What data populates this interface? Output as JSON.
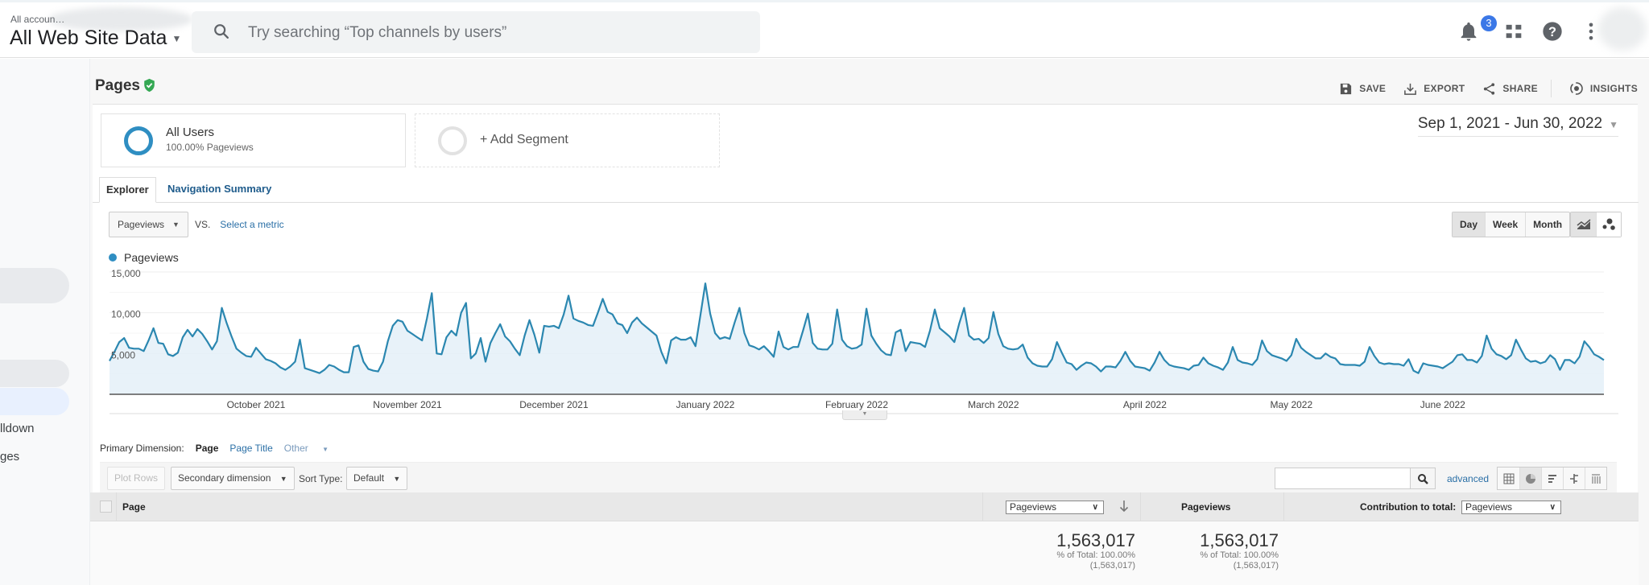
{
  "topbar": {
    "account_small": "All accoun…",
    "property_view": "All Web Site Data",
    "search_placeholder": "Try searching “Top channels by users”",
    "notification_count": "3",
    "icons": [
      "notifications-bell-icon",
      "apps-grid-icon",
      "help-icon",
      "more-vert-icon"
    ]
  },
  "sidebar": {
    "fragments": [
      "lldown",
      "ges"
    ]
  },
  "page": {
    "title": "Pages",
    "actions": [
      {
        "label": "SAVE",
        "icon": "save-icon"
      },
      {
        "label": "EXPORT",
        "icon": "export-icon"
      },
      {
        "label": "SHARE",
        "icon": "share-icon"
      },
      {
        "label": "INSIGHTS",
        "icon": "insights-icon"
      }
    ],
    "date_range": "Sep 1, 2021 - Jun 30, 2022"
  },
  "segments": [
    {
      "title": "All Users",
      "subtitle": "100.00% Pageviews",
      "color": "#2f8ec2"
    },
    {
      "title": "+ Add Segment",
      "subtitle": ""
    }
  ],
  "tabs": [
    {
      "label": "Explorer",
      "active": true
    },
    {
      "label": "Navigation Summary",
      "active": false
    }
  ],
  "metric_selector": {
    "metric": "Pageviews",
    "vs_label": "VS.",
    "compare_link": "Select a metric"
  },
  "granularity": {
    "options": [
      "Day",
      "Week",
      "Month"
    ],
    "selected": "Day"
  },
  "chart_type_buttons": [
    "line-chart-icon",
    "motion-chart-icon"
  ],
  "chart_data": {
    "type": "area",
    "title": "",
    "legend": [
      {
        "name": "Pageviews",
        "color": "#2f8ec2"
      }
    ],
    "legend_placement": "top-left",
    "xlabel": "",
    "ylabel": "",
    "ylim": [
      0,
      15000
    ],
    "yticks": [
      5000,
      10000,
      15000
    ],
    "ytick_labels": [
      "5,000",
      "10,000",
      "15,000"
    ],
    "x_start": "Sep 1, 2021",
    "x_end": "Jun 30, 2022",
    "xtick_labels": [
      {
        "label": "October 2021",
        "day_index": 30
      },
      {
        "label": "November 2021",
        "day_index": 61
      },
      {
        "label": "December 2021",
        "day_index": 91
      },
      {
        "label": "January 2022",
        "day_index": 122
      },
      {
        "label": "February 2022",
        "day_index": 153
      },
      {
        "label": "March 2022",
        "day_index": 181
      },
      {
        "label": "April 2022",
        "day_index": 212
      },
      {
        "label": "May 2022",
        "day_index": 242
      },
      {
        "label": "June 2022",
        "day_index": 273
      }
    ],
    "series": [
      {
        "name": "Pageviews",
        "values": [
          4100,
          5200,
          6400,
          6900,
          5700,
          5600,
          5600,
          5300,
          6600,
          8100,
          6300,
          6200,
          4900,
          4700,
          5100,
          7000,
          7900,
          7100,
          8000,
          7400,
          6500,
          5500,
          6500,
          10600,
          8700,
          7100,
          5600,
          5100,
          4700,
          4600,
          5700,
          5000,
          4300,
          4100,
          3800,
          3300,
          3000,
          3400,
          4000,
          6700,
          3200,
          3000,
          2800,
          2600,
          3000,
          3600,
          3400,
          3000,
          2700,
          2700,
          5800,
          6000,
          4000,
          3100,
          2900,
          2800,
          4000,
          6500,
          8400,
          9100,
          8900,
          7800,
          7400,
          7000,
          6600,
          9300,
          12400,
          5000,
          4900,
          7000,
          7800,
          7200,
          10000,
          11200,
          4400,
          5000,
          6900,
          4000,
          6300,
          7500,
          8600,
          7100,
          6500,
          5600,
          4800,
          7200,
          9100,
          7300,
          5100,
          8400,
          8300,
          8400,
          8100,
          9800,
          12100,
          9300,
          9000,
          8800,
          8500,
          8400,
          10000,
          11700,
          10100,
          9800,
          8700,
          8500,
          7500,
          8800,
          9400,
          8700,
          8200,
          7700,
          7200,
          5200,
          3800,
          6600,
          7000,
          6700,
          6700,
          7000,
          5900,
          9700,
          13600,
          9900,
          7500,
          6800,
          7000,
          6800,
          8800,
          10600,
          7500,
          6000,
          5800,
          5500,
          5900,
          5300,
          4600,
          7700,
          5800,
          5500,
          5800,
          5800,
          7800,
          9900,
          6300,
          5600,
          5500,
          5500,
          6200,
          10400,
          6700,
          5900,
          5600,
          5700,
          6100,
          10500,
          7200,
          6200,
          5400,
          4900,
          4800,
          7600,
          7900,
          5300,
          6400,
          6300,
          6200,
          5800,
          7800,
          10400,
          8100,
          7600,
          7100,
          6400,
          8700,
          10600,
          7200,
          6700,
          6800,
          6300,
          6900,
          10100,
          7400,
          5900,
          5600,
          5500,
          5600,
          6100,
          4500,
          3800,
          3500,
          3400,
          3400,
          4300,
          6400,
          5100,
          3900,
          3700,
          3000,
          3500,
          3900,
          3800,
          3400,
          2800,
          3400,
          3400,
          3300,
          4100,
          5200,
          4100,
          3400,
          3300,
          3200,
          2900,
          3900,
          5200,
          4200,
          3600,
          3400,
          3300,
          3200,
          3000,
          3500,
          3600,
          4500,
          3800,
          3500,
          3300,
          3000,
          3900,
          5800,
          4200,
          3900,
          3800,
          3600,
          4300,
          6600,
          5300,
          4800,
          4600,
          4400,
          4100,
          4800,
          6800,
          5700,
          5200,
          4800,
          4400,
          4400,
          5000,
          4600,
          4400,
          3700,
          3600,
          3600,
          3600,
          3500,
          4000,
          5800,
          4700,
          3900,
          3700,
          3800,
          3700,
          3700,
          3500,
          4300,
          2900,
          2600,
          3800,
          3600,
          3500,
          3400,
          3200,
          3600,
          4000,
          4800,
          4900,
          4200,
          4200,
          3900,
          4700,
          7200,
          5600,
          4900,
          4700,
          4300,
          4800,
          6700,
          5500,
          4400,
          4000,
          4100,
          3800,
          4000,
          4800,
          4300,
          3000,
          4200,
          4200,
          3800,
          4600,
          6500,
          5800,
          4900,
          4600,
          4200
        ]
      }
    ]
  },
  "primary_dimension": {
    "label": "Primary Dimension:",
    "selected": "Page",
    "options": [
      "Page Title",
      "Other"
    ]
  },
  "table_toolbar": {
    "plot_rows": "Plot Rows",
    "secondary_dimension": "Secondary dimension",
    "sort_type_label": "Sort Type:",
    "sort_type_value": "Default",
    "search_value": "",
    "advanced_link": "advanced",
    "view_icons": [
      "data-table-icon",
      "percentage-pie-icon",
      "performance-bars-icon",
      "comparison-icon",
      "term-cloud-icon"
    ],
    "selected_view": "percentage-pie-icon"
  },
  "table": {
    "columns": {
      "page": "Page",
      "metric_select": "Pageviews",
      "metric_header": "Pageviews",
      "contribution_label": "Contribution to total:",
      "contribution_select": "Pageviews"
    },
    "totals": [
      {
        "value": "1,563,017",
        "pct": "% of Total: 100.00%",
        "abs": "(1,563,017)"
      },
      {
        "value": "1,563,017",
        "pct": "% of Total: 100.00%",
        "abs": "(1,563,017)"
      }
    ]
  }
}
